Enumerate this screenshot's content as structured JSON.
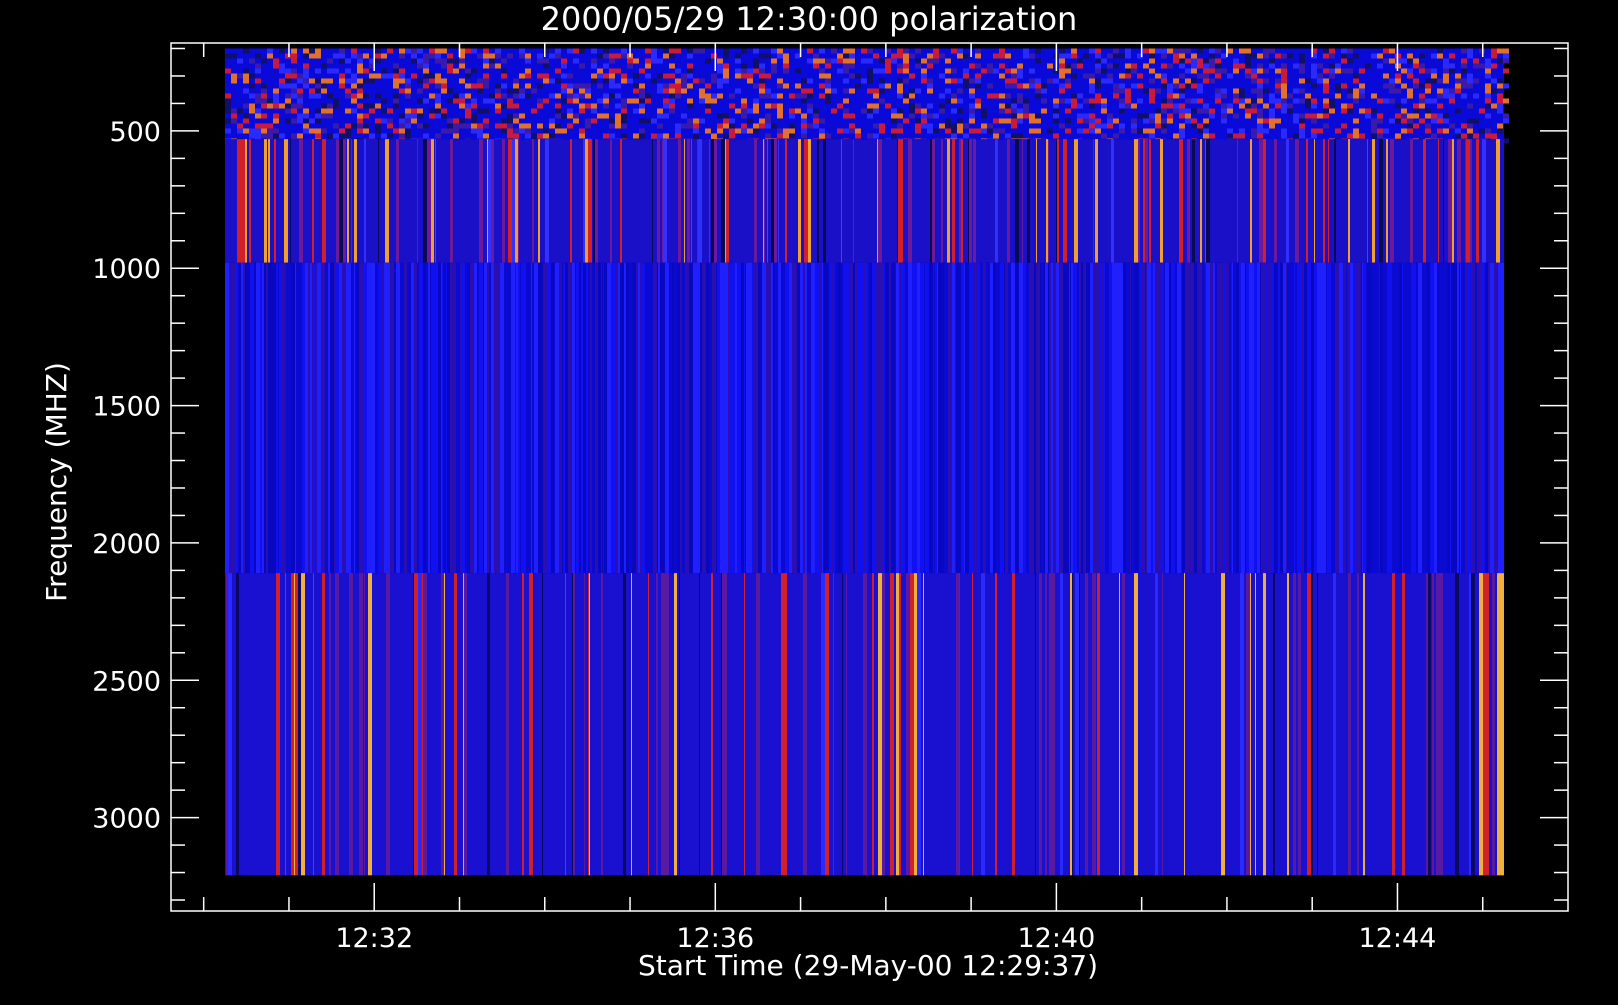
{
  "chart_data": {
    "type": "heatmap",
    "title": "2000/05/29 12:30:00 polarization",
    "xlabel": "Start Time (29-May-00 12:29:37)",
    "ylabel": "Frequency (MHZ)",
    "x_range": [
      "12:29:37",
      "12:46:00"
    ],
    "y_range": [
      180,
      3340
    ],
    "y_reversed": true,
    "x_ticks": [
      "12:32",
      "12:36",
      "12:40",
      "12:44"
    ],
    "y_ticks": [
      500,
      1000,
      1500,
      2000,
      2500,
      3000
    ],
    "data_extent": {
      "time_start": "12:30:15",
      "time_end": "12:45:15",
      "freq_min": 200,
      "freq_max": 3210
    },
    "bands": [
      {
        "freq_from": 200,
        "freq_to": 530,
        "pattern": "speckled noise",
        "palette": [
          "#0a0ad8",
          "#3a1aa8",
          "#c81a3a",
          "#e0702a",
          "#2a2aff",
          "#10106a"
        ]
      },
      {
        "freq_from": 530,
        "freq_to": 980,
        "pattern": "vertical streaks",
        "palette": [
          "#1a10c8",
          "#6a1a9a",
          "#d0202a",
          "#f0a030",
          "#0a0a50",
          "#3030ff"
        ]
      },
      {
        "freq_from": 980,
        "freq_to": 2110,
        "pattern": "vertical streaks",
        "palette": [
          "#1010f0",
          "#0a0ad0",
          "#2020ff",
          "#2a10b0",
          "#0808c0"
        ]
      },
      {
        "freq_from": 2110,
        "freq_to": 3210,
        "pattern": "vertical streaks",
        "palette": [
          "#1a10d0",
          "#5a1aa0",
          "#d0202a",
          "#f0b040",
          "#0a0a60",
          "#2a2aff"
        ]
      }
    ],
    "colors": {
      "background": "#000000",
      "axis": "#ffffff",
      "dominant": "#1414e6"
    }
  }
}
